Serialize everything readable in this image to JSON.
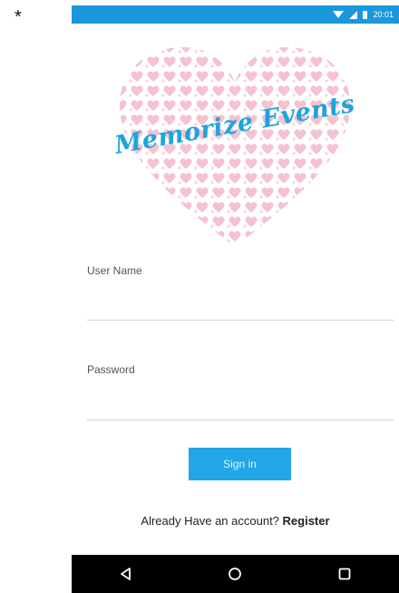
{
  "corner_mark": "*",
  "status_bar": {
    "time": "20:01",
    "color": "#1b97db"
  },
  "app": {
    "logo_title": "Memorize Events",
    "logo_color": "#1ea4dc",
    "heart_color": "#f4b8c8"
  },
  "form": {
    "username_label": "User Name",
    "username_value": "",
    "password_label": "Password",
    "password_value": "",
    "signin_label": "Sign in",
    "signin_color": "#23a6e6"
  },
  "footer": {
    "prompt": "Already Have an account?",
    "register_label": "Register"
  },
  "nav": {
    "back_icon": "back-triangle-icon",
    "home_icon": "home-circle-icon",
    "recents_icon": "recents-square-icon"
  }
}
